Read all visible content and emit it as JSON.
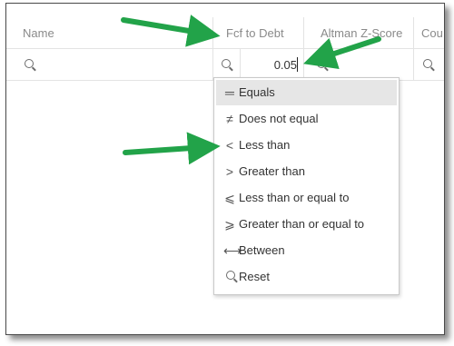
{
  "columns": {
    "name": "Name",
    "fcf_to_debt": "Fcf to Debt",
    "altman": "Altman Z-Score",
    "cou": "Cou"
  },
  "filter": {
    "value": "0.05"
  },
  "menu": {
    "items": [
      {
        "label": "Equals",
        "icon": "="
      },
      {
        "label": "Does not equal",
        "icon": "≠"
      },
      {
        "label": "Less than",
        "icon": "<"
      },
      {
        "label": "Greater than",
        "icon": ">"
      },
      {
        "label": "Less than or equal to",
        "icon": "⩽"
      },
      {
        "label": "Greater than or equal to",
        "icon": "⩾"
      },
      {
        "label": "Between",
        "icon": "⟷"
      },
      {
        "label": "Reset",
        "icon": "search-icon"
      }
    ],
    "selected_index": 0
  },
  "colors": {
    "arrow_green": "#22a349",
    "selected_bg": "#e6e6e6",
    "header_text": "#8a8a8a"
  }
}
